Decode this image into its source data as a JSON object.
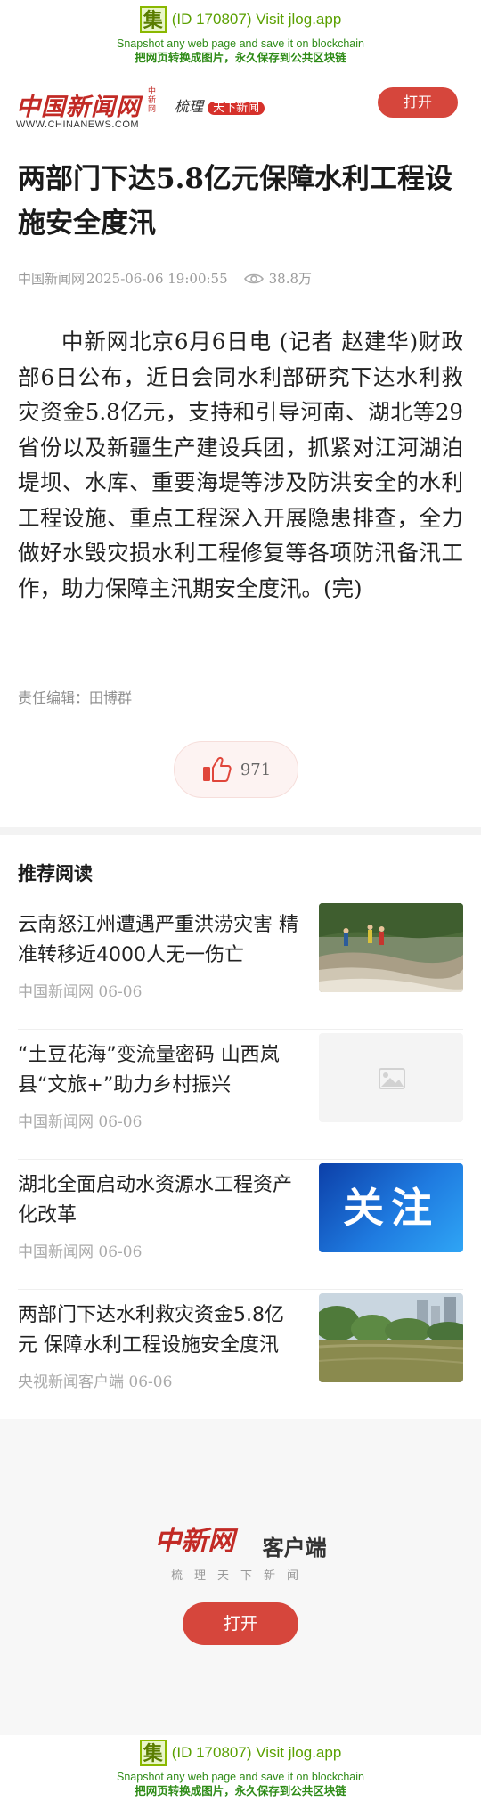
{
  "jlog": {
    "badge": "集",
    "id_text": "(ID 170807) Visit jlog.app",
    "line2": "Snapshot any web page and save it on blockchain",
    "line3": "把网页转换成图片，永久保存到公共区块链"
  },
  "header": {
    "logo": "中国新闻网",
    "logo_vertical": "中新网",
    "url": "WWW.CHINANEWS.COM",
    "slogan": "梳理",
    "slogan_badge": "天下新闻",
    "open_button": "打开"
  },
  "article": {
    "title": "两部门下达5.8亿元保障水利工程设施安全度汛",
    "source": "中国新闻网",
    "datetime": "2025-06-06 19:00:55",
    "views": "38.8万",
    "body": "中新网北京6月6日电 (记者 赵建华)财政部6日公布，近日会同水利部研究下达水利救灾资金5.8亿元，支持和引导河南、湖北等29省份以及新疆生产建设兵团，抓紧对江河湖泊堤坝、水库、重要海堤等涉及防洪安全的水利工程设施、重点工程深入开展隐患排查，全力做好水毁灾损水利工程修复等各项防汛备汛工作，助力保障主汛期安全度汛。(完)",
    "editor": "责任编辑：田博群",
    "likes": "971"
  },
  "recommend": {
    "heading": "推荐阅读",
    "items": [
      {
        "title": "云南怒江州遭遇严重洪涝灾害 精准转移近4000人无一伤亡",
        "source": "中国新闻网 06-06"
      },
      {
        "title": "“土豆花海”变流量密码 山西岚县“文旅+”助力乡村振兴",
        "source": "中国新闻网 06-06"
      },
      {
        "title": "湖北全面启动水资源水工程资产化改革",
        "source": "中国新闻网 06-06",
        "thumb_text": "关注"
      },
      {
        "title": "两部门下达水利救灾资金5.8亿元 保障水利工程设施安全度汛",
        "source": "央视新闻客户端 06-06"
      }
    ]
  },
  "promo": {
    "logo": "中新网",
    "client": "客户端",
    "subtitle": "梳理天下新闻",
    "open_button": "打开"
  },
  "colors": {
    "brand_red": "#c22a25",
    "button_red": "#d6463c",
    "jlog_green": "#2e8b17"
  }
}
